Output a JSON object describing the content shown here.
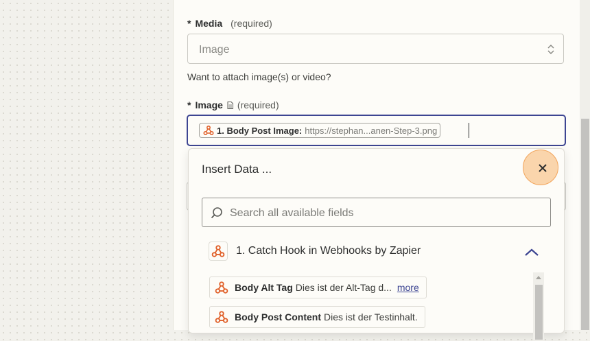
{
  "form": {
    "media": {
      "star": "*",
      "label": "Media",
      "required": "(required)",
      "value": "Image",
      "help": "Want to attach image(s) or video?"
    },
    "image": {
      "star": "*",
      "label": "Image",
      "required": "(required)",
      "pill_key": "1. Body Post Image:",
      "pill_value": "https://stephan...anen-Step-3.png"
    }
  },
  "insert_data": {
    "title": "Insert Data ...",
    "search_placeholder": "Search all available fields",
    "app_name": "1. Catch Hook in Webhooks by Zapier",
    "fields": [
      {
        "key": "Body Alt Tag",
        "value": "Dies ist der Alt-Tag d...",
        "more": "more"
      },
      {
        "key": "Body Post Content",
        "value": "Dies ist der Testinhalt."
      }
    ]
  },
  "colors": {
    "accent": "#3d4592",
    "webhook_icon": "#e0602a",
    "close_highlight": "#f8b46e"
  },
  "icons": [
    "doc-icon",
    "webhook-icon",
    "close-icon",
    "search-icon",
    "chevron-up-icon",
    "select-chevrons-icon"
  ]
}
